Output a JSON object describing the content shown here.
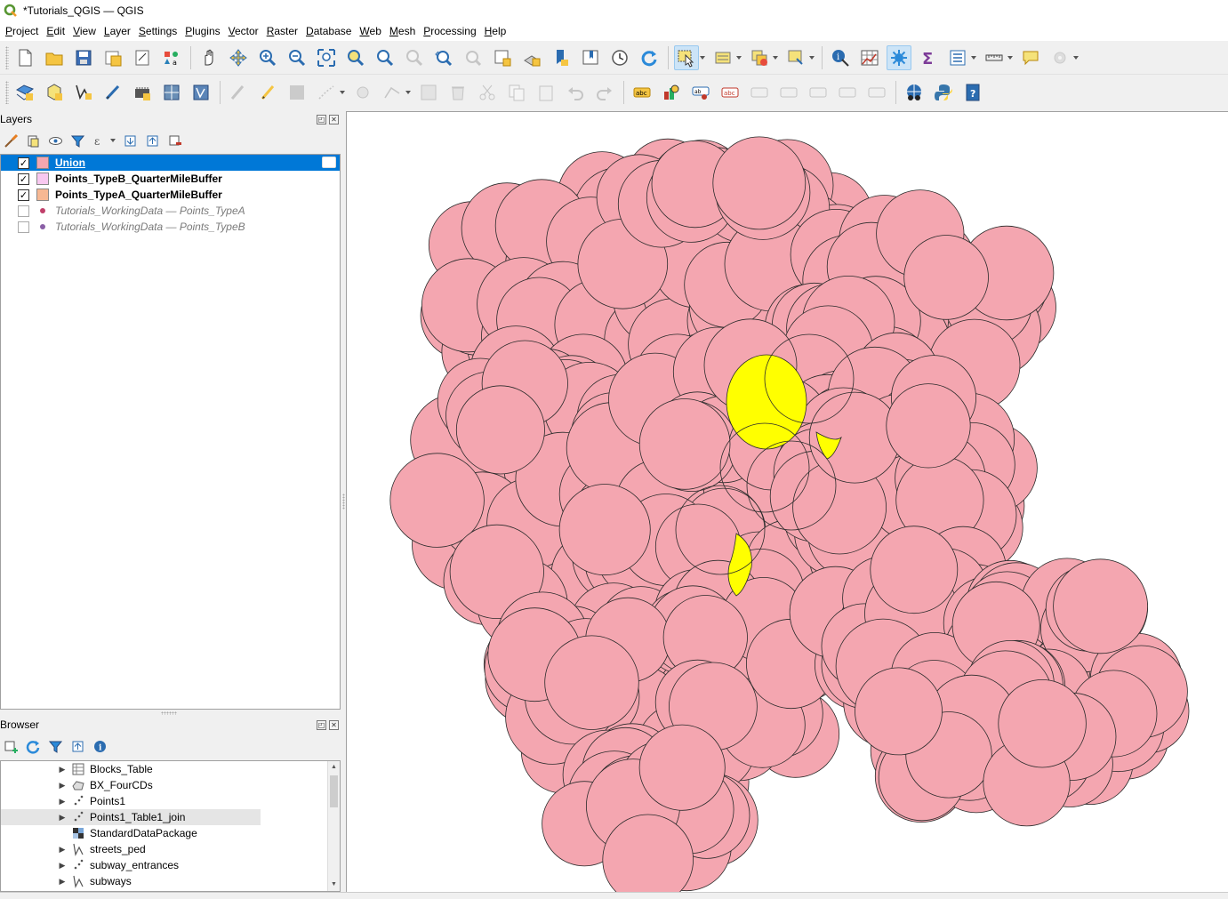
{
  "window": {
    "title": "*Tutorials_QGIS — QGIS"
  },
  "menu": [
    "Project",
    "Edit",
    "View",
    "Layer",
    "Settings",
    "Plugins",
    "Vector",
    "Raster",
    "Database",
    "Web",
    "Mesh",
    "Processing",
    "Help"
  ],
  "layers_panel": {
    "title": "Layers",
    "items": [
      {
        "name": "Union",
        "checked": true,
        "selected": true,
        "symbol": "fill",
        "color": "#f4a6b0"
      },
      {
        "name": "Points_TypeB_QuarterMileBuffer",
        "checked": true,
        "selected": false,
        "symbol": "fill",
        "color": "#f8c8f0"
      },
      {
        "name": "Points_TypeA_QuarterMileBuffer",
        "checked": true,
        "selected": false,
        "symbol": "fill",
        "color": "#f7b893"
      },
      {
        "name": "Tutorials_WorkingData — Points_TypeA",
        "checked": false,
        "selected": false,
        "symbol": "point",
        "color": "#c0406a"
      },
      {
        "name": "Tutorials_WorkingData — Points_TypeB",
        "checked": false,
        "selected": false,
        "symbol": "point",
        "color": "#8a5fa6"
      }
    ]
  },
  "browser_panel": {
    "title": "Browser",
    "items": [
      {
        "name": "Blocks_Table",
        "icon": "table-icon",
        "expandable": true
      },
      {
        "name": "BX_FourCDs",
        "icon": "polygon-layer-icon",
        "expandable": true
      },
      {
        "name": "Points1",
        "icon": "point-layer-icon",
        "expandable": true
      },
      {
        "name": "Points1_Table1_join",
        "icon": "point-layer-icon",
        "expandable": true,
        "hover": true
      },
      {
        "name": "StandardDataPackage",
        "icon": "raster-icon",
        "expandable": false
      },
      {
        "name": "streets_ped",
        "icon": "line-layer-icon",
        "expandable": true
      },
      {
        "name": "subway_entrances",
        "icon": "point-layer-icon",
        "expandable": true
      },
      {
        "name": "subways",
        "icon": "line-layer-icon",
        "expandable": true
      }
    ]
  },
  "map": {
    "fill_color": "#f4a6b0",
    "outline_color": "#2b2b2b",
    "highlight_color": "#ffff00"
  }
}
